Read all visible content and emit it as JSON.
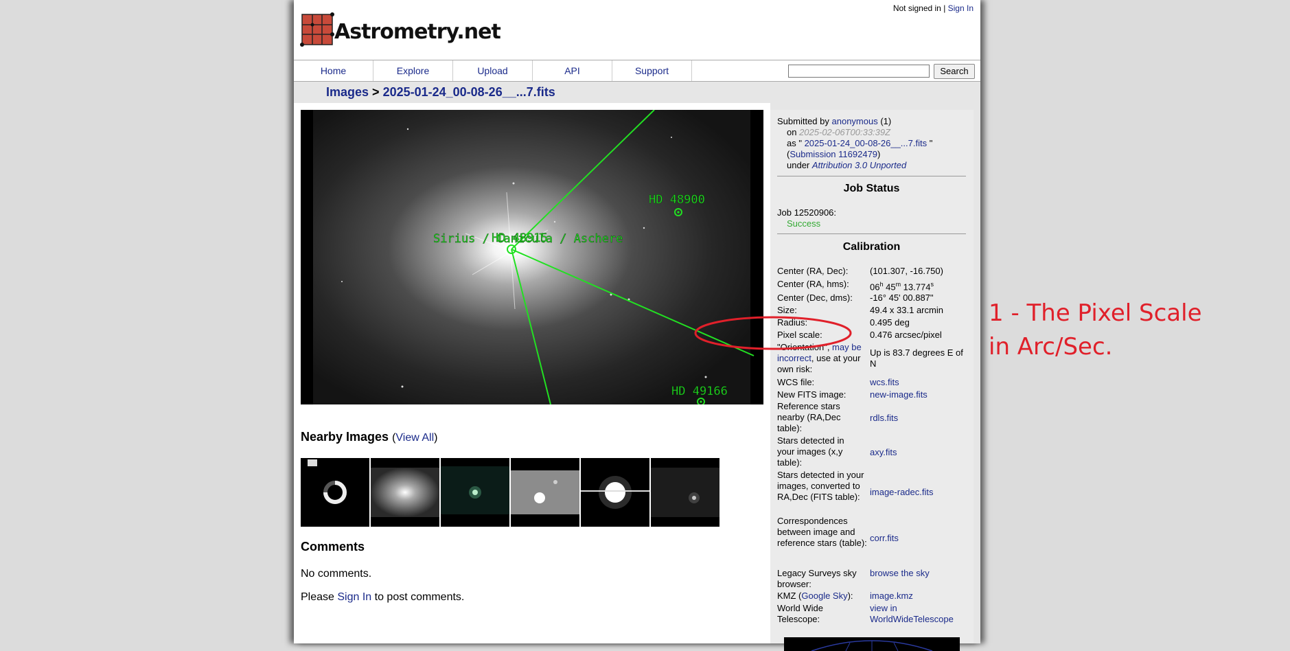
{
  "header": {
    "not_signed_in": "Not signed in | ",
    "sign_in": "Sign In",
    "logo_text": "Astrometry.net"
  },
  "nav": {
    "items": [
      "Home",
      "Explore",
      "Upload",
      "API",
      "Support"
    ],
    "search_button": "Search",
    "search_value": ""
  },
  "breadcrumb": {
    "images": "Images",
    "sep": " > ",
    "file": "2025-01-24_00-08-26__...7.fits"
  },
  "sky_labels": {
    "hd48900": "HD 48900",
    "hd49166": "HD 49166",
    "sirius": "Sirius / Canicula / Aschere",
    "overlap": "HD 48915"
  },
  "nearby": {
    "title": "Nearby Images ",
    "view_all_open": "(",
    "view_all": "View All",
    "view_all_close": ")"
  },
  "comments": {
    "title": "Comments",
    "none": "No comments.",
    "please": "Please ",
    "sign_in": "Sign In",
    "to_post": " to post comments."
  },
  "submission": {
    "submitted_by": "Submitted by ",
    "user": "anonymous",
    "user_count": " (1)",
    "on": "on ",
    "date": "2025-02-06T00:33:39Z",
    "as_prefix": "as \" ",
    "as_file": "2025-01-24_00-08-26__...7.fits",
    "as_suffix": " \"",
    "sub_open": "(",
    "sub_link": "Submission 11692479",
    "sub_close": ")",
    "under": "under ",
    "license": "Attribution 3.0 Unported"
  },
  "job_status": {
    "title": "Job Status",
    "job": "Job 12520906:",
    "status": "Success",
    "status_color": "#33aa33"
  },
  "calibration": {
    "title": "Calibration",
    "center_radec_label": "Center (RA, Dec):",
    "center_radec": "(101.307, -16.750)",
    "center_hms_label": "Center (RA, hms):",
    "ra_h": "06",
    "ra_h_unit": "h",
    "ra_m": " 45",
    "ra_m_unit": "m",
    "ra_s": " 13.774",
    "ra_s_unit": "s",
    "center_dms_label": "Center (Dec, dms):",
    "center_dms": "-16° 45' 00.887\"",
    "size_label": "Size:",
    "size": "49.4 x 33.1 arcmin",
    "radius_label": "Radius:",
    "radius": "0.495 deg",
    "pixel_scale_label": "Pixel scale:",
    "pixel_scale": "0.476 arcsec/pixel",
    "orientation_label_1": "\"Orientation\", ",
    "orientation_label_link": "may be incorrect",
    "orientation_label_2": ", use at your own risk:",
    "orientation": "Up is 83.7 degrees E of N",
    "wcs_label": "WCS file:",
    "wcs": "wcs.fits",
    "newfits_label": "New FITS image:",
    "newfits": "new-image.fits",
    "ref_label": "Reference stars nearby (RA,Dec table):",
    "ref": "rdls.fits",
    "axy_label": "Stars detected in your images (x,y table):",
    "axy": "axy.fits",
    "radec_label": "Stars detected in your images, converted to RA,Dec (FITS table):",
    "radec": "image-radec.fits",
    "corr_label": "Correspondences between image and reference stars (table):",
    "corr": "corr.fits",
    "legacy_label": "Legacy Surveys sky browser:",
    "legacy": "browse the sky",
    "kmz_label_1": "KMZ (",
    "kmz_label_link": "Google Sky",
    "kmz_label_2": "):",
    "kmz": "image.kmz",
    "wwt_label": "World Wide Telescope:",
    "wwt": "view in WorldWideTelescope"
  },
  "annotation": {
    "text": "1 - The Pixel Scale in Arc/Sec.",
    "color": "#e0202a"
  }
}
